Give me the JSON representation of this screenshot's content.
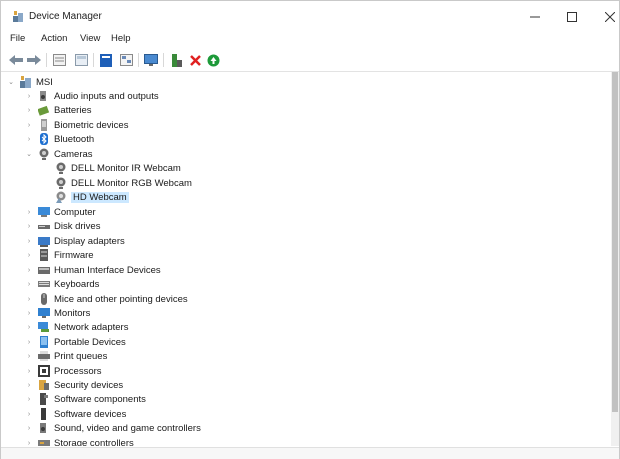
{
  "window": {
    "title": "Device Manager"
  },
  "menu": [
    "File",
    "Action",
    "View",
    "Help"
  ],
  "toolbar": {
    "buttons": [
      "back-icon",
      "forward-icon",
      "properties-sheet-icon",
      "list-view-icon",
      "help-icon",
      "resource-view-icon",
      "monitor-icon",
      "update-driver-icon",
      "uninstall-icon",
      "enable-icon"
    ]
  },
  "tree": {
    "root": "MSI",
    "nodes": [
      {
        "label": "Audio inputs and outputs",
        "icon": "speaker-icon",
        "expanded": false
      },
      {
        "label": "Batteries",
        "icon": "battery-icon",
        "expanded": false
      },
      {
        "label": "Biometric devices",
        "icon": "biometric-icon",
        "expanded": false
      },
      {
        "label": "Bluetooth",
        "icon": "bluetooth-icon",
        "expanded": false
      },
      {
        "label": "Cameras",
        "icon": "camera-icon",
        "expanded": true,
        "children": [
          {
            "label": "DELL Monitor IR Webcam",
            "icon": "camera-icon"
          },
          {
            "label": "DELL Monitor RGB Webcam",
            "icon": "camera-icon"
          },
          {
            "label": "HD Webcam",
            "icon": "camera-warning-icon",
            "selected": true
          }
        ]
      },
      {
        "label": "Computer",
        "icon": "computer-icon",
        "expanded": false
      },
      {
        "label": "Disk drives",
        "icon": "disk-icon",
        "expanded": false
      },
      {
        "label": "Display adapters",
        "icon": "display-adapter-icon",
        "expanded": false
      },
      {
        "label": "Firmware",
        "icon": "firmware-icon",
        "expanded": false
      },
      {
        "label": "Human Interface Devices",
        "icon": "hid-icon",
        "expanded": false
      },
      {
        "label": "Keyboards",
        "icon": "keyboard-icon",
        "expanded": false
      },
      {
        "label": "Mice and other pointing devices",
        "icon": "mouse-icon",
        "expanded": false
      },
      {
        "label": "Monitors",
        "icon": "monitor-icon",
        "expanded": false
      },
      {
        "label": "Network adapters",
        "icon": "network-icon",
        "expanded": false
      },
      {
        "label": "Portable Devices",
        "icon": "portable-icon",
        "expanded": false
      },
      {
        "label": "Print queues",
        "icon": "printer-icon",
        "expanded": false
      },
      {
        "label": "Processors",
        "icon": "processor-icon",
        "expanded": false
      },
      {
        "label": "Security devices",
        "icon": "security-icon",
        "expanded": false
      },
      {
        "label": "Software components",
        "icon": "software-component-icon",
        "expanded": false
      },
      {
        "label": "Software devices",
        "icon": "software-device-icon",
        "expanded": false
      },
      {
        "label": "Sound, video and game controllers",
        "icon": "sound-icon",
        "expanded": false
      },
      {
        "label": "Storage controllers",
        "icon": "storage-icon",
        "expanded": false
      }
    ]
  },
  "colors": {
    "selection": "#cce8ff",
    "accent": "#1e73c8"
  }
}
